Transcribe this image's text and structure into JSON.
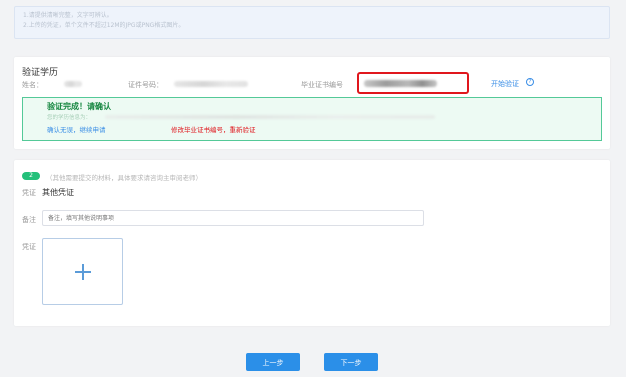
{
  "notice": {
    "lines": [
      "1.请提供清晰完整，文字可辨认。",
      "2.上传的凭证，单个文件不超过12M的JPG或PNG格式图片。"
    ]
  },
  "education": {
    "title": "验证学历",
    "name_label": "姓名：",
    "id_label": "证件号码：",
    "cert_label": "毕业证书编号",
    "verify_link": "开始验证",
    "help_icon": "?"
  },
  "success": {
    "title": "验证完成！请确认",
    "subtitle": "您的学历信息为：",
    "confirm_link": "确认无误，继续申请",
    "modify_link": "修改毕业证书编号，重新验证"
  },
  "other": {
    "step_badge": "2",
    "hint": "（其他需要提交的材料，具体要求请咨询主审阅老师）",
    "voucher_label": "凭证",
    "voucher_value": "其他凭证",
    "remark_label": "备注",
    "remark_placeholder": "备注，填写其他说明事项",
    "upload_label": "凭证",
    "upload_icon": "plus-icon"
  },
  "footer": {
    "prev_label": "上一步",
    "next_label": "下一步"
  },
  "colors": {
    "primary": "#2b8fe8",
    "success_bg": "#edfaf3",
    "success_border": "#54c998",
    "highlight": "#e0171d"
  }
}
